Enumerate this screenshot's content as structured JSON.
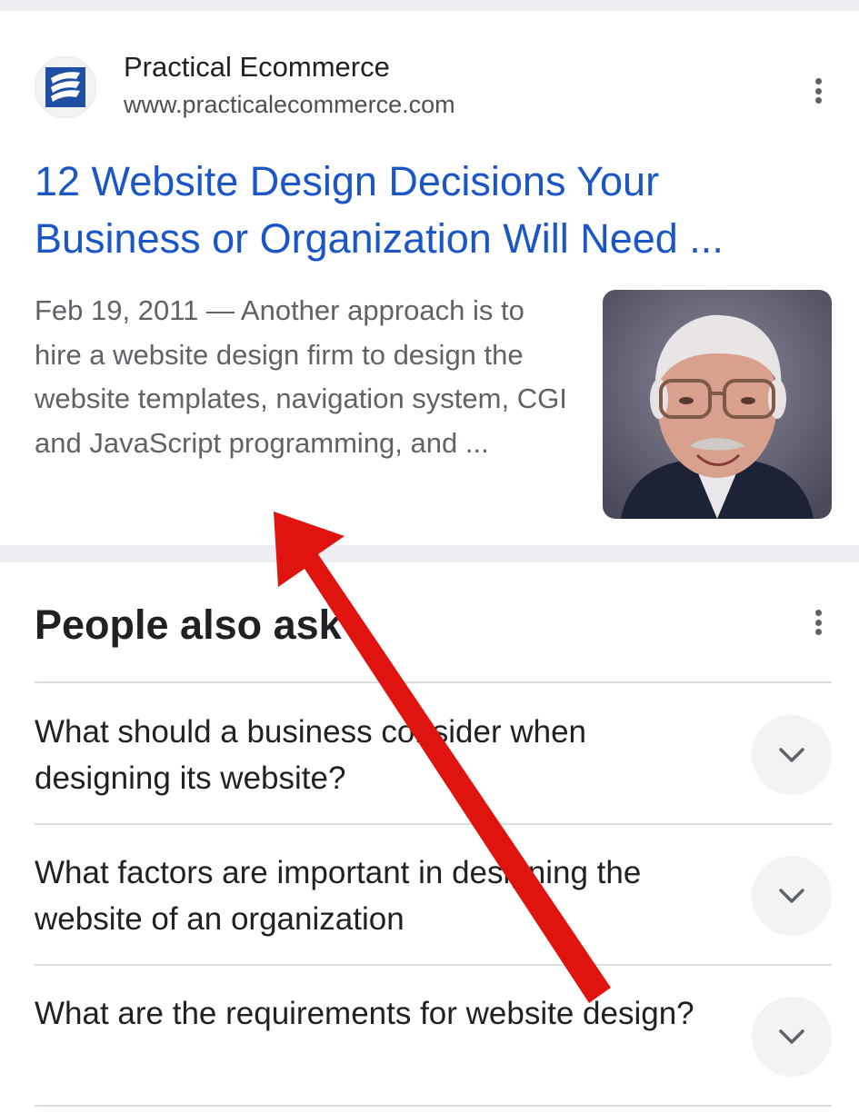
{
  "result": {
    "site_name": "Practical Ecommerce",
    "site_url": "www.practicalecommerce.com",
    "favicon_icon": "practical-ecommerce-logo",
    "title": "12 Website Design Decisions Your Business or Organization Will Need ...",
    "snippet": "Feb 19, 2011 — Another approach is to hire a website design firm to design the website templates, navigation system, CGI and JavaScript programming, and ...",
    "menu_icon": "more-vert-icon",
    "link_color": "#1a56c7"
  },
  "people_also_ask": {
    "title": "People also ask",
    "menu_icon": "more-vert-icon",
    "questions": [
      "What should a business consider when designing its website?",
      "What factors are important in designing the website of an organization",
      "What are the requirements for website design?"
    ],
    "expand_icon": "chevron-down-icon"
  },
  "annotation": {
    "icon": "red-arrow-icon",
    "color": "#e0140f"
  }
}
